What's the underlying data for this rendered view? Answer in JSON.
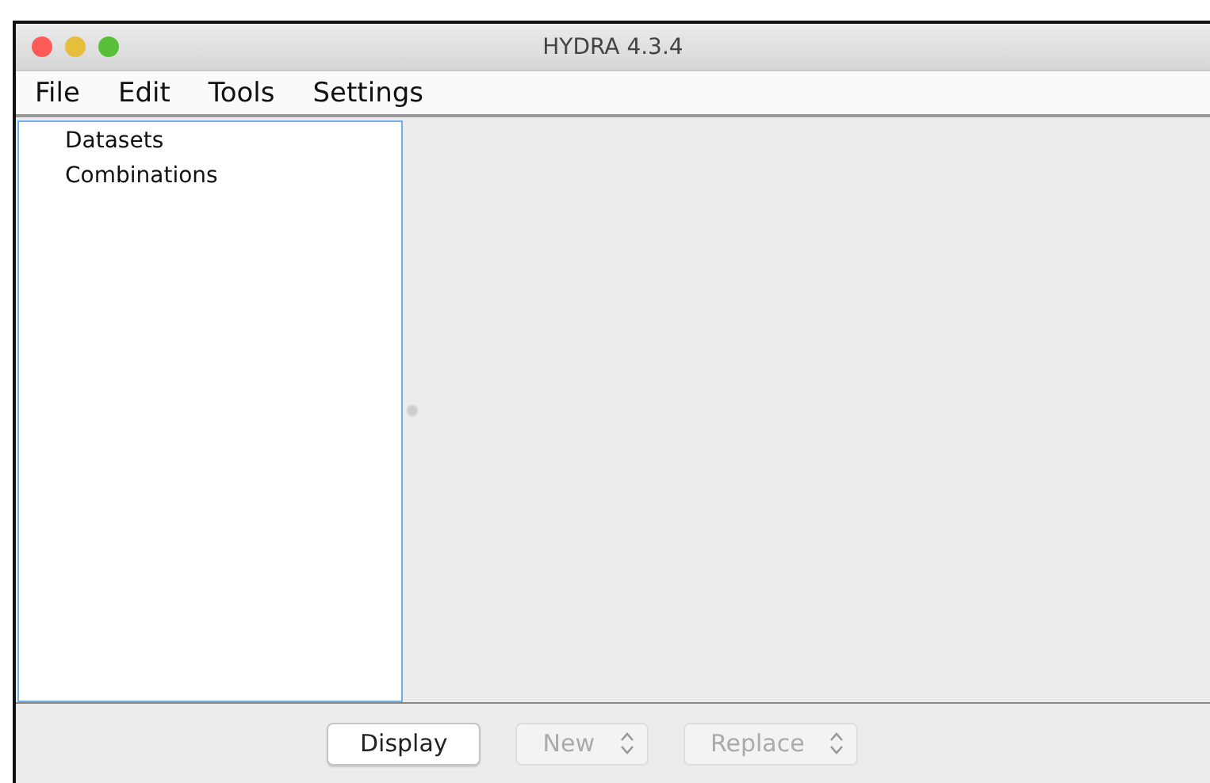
{
  "window": {
    "title": "HYDRA 4.3.4"
  },
  "menu": [
    "File",
    "Edit",
    "Tools",
    "Settings"
  ],
  "tree": {
    "items": [
      {
        "label": "Datasets"
      },
      {
        "label": "Combinations"
      }
    ]
  },
  "buttons": [
    {
      "kind": "button",
      "label": "Display",
      "disabled": false
    },
    {
      "kind": "select",
      "label": "New",
      "disabled": true
    },
    {
      "kind": "select",
      "label": "Replace",
      "disabled": true
    }
  ]
}
